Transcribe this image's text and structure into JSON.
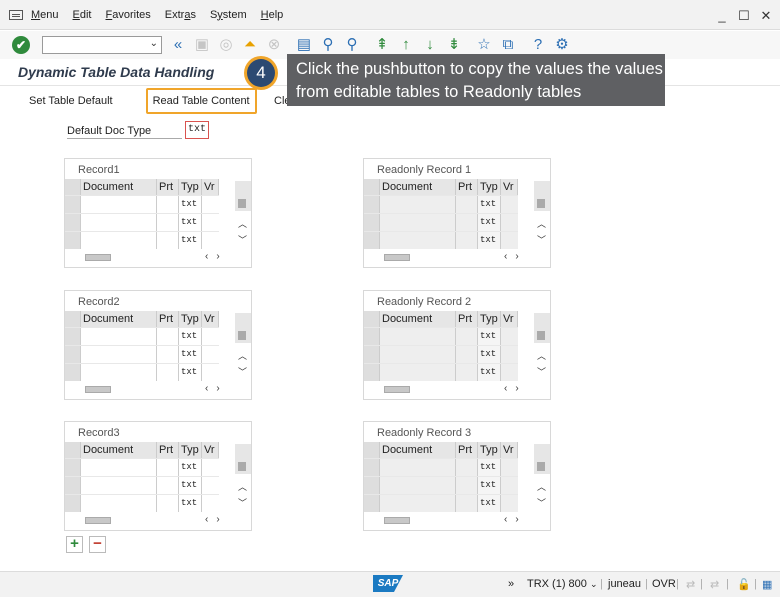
{
  "menu": {
    "items": [
      "Menu",
      "Edit",
      "Favorites",
      "Extras",
      "System",
      "Help"
    ],
    "underline": [
      "M",
      "E",
      "F",
      "a",
      "y",
      "H"
    ]
  },
  "window_controls": [
    "_",
    "☐",
    "✕"
  ],
  "toolbar": {
    "icons": [
      "enter-icon",
      "command-field",
      "back-icon",
      "save-icon",
      "exit-icon",
      "cancel-icon",
      "print-icon",
      "find-icon",
      "find-next-icon",
      "first-page-icon",
      "previous-page-icon",
      "next-page-icon",
      "last-page-icon",
      "new-session-icon",
      "shortcut-icon",
      "help-icon",
      "settings-icon"
    ]
  },
  "title": "Dynamic Table Data Handling",
  "app_toolbar": {
    "set_default": "Set Table Default",
    "read_content": "Read Table Content",
    "clear_partial": "Cle"
  },
  "field": {
    "label": "Default Doc Type",
    "value": "txt"
  },
  "columns": [
    "Document",
    "Prt",
    "Typ",
    "Vr"
  ],
  "tables": [
    {
      "caption": "Record1",
      "rows": [
        "txt",
        "txt",
        "txt"
      ]
    },
    {
      "caption": "Readonly Record 1",
      "rows": [
        "txt",
        "txt",
        "txt"
      ]
    },
    {
      "caption": "Record2",
      "rows": [
        "txt",
        "txt",
        "txt"
      ]
    },
    {
      "caption": "Readonly Record 2",
      "rows": [
        "txt",
        "txt",
        "txt"
      ]
    },
    {
      "caption": "Record3",
      "rows": [
        "txt",
        "txt",
        "txt"
      ]
    },
    {
      "caption": "Readonly Record 3",
      "rows": [
        "txt",
        "txt",
        "txt"
      ]
    }
  ],
  "callout": {
    "step": "4",
    "text": "Click the pushbutton to copy the values the values from editable tables to Readonly tables"
  },
  "statusbar": {
    "logo": "SAP",
    "expand": "»",
    "system": "TRX (1) 800",
    "user": "juneau",
    "mode": "OVR"
  }
}
